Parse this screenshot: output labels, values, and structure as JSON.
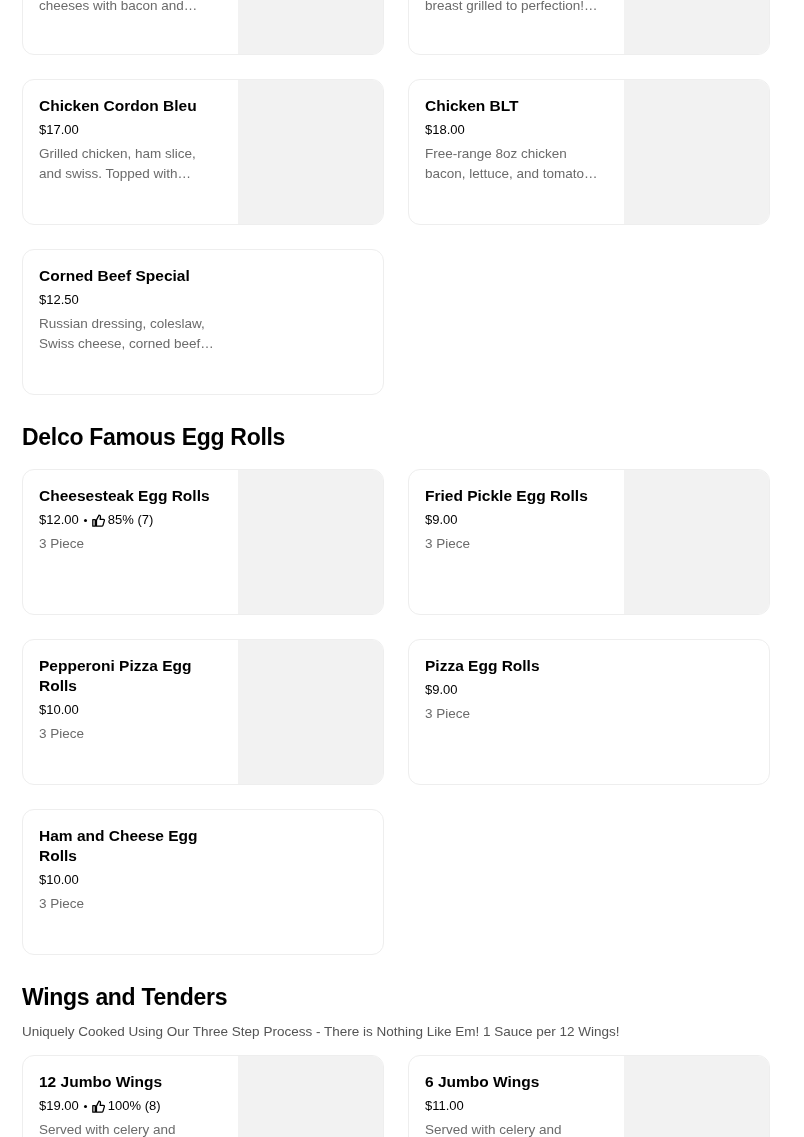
{
  "sections": [
    {
      "items": [
        {
          "kind": "partial",
          "description": "cheeses with bacon and…",
          "image": true
        },
        {
          "kind": "partial",
          "description": "breast grilled to perfection!…",
          "image": true
        },
        {
          "kind": "full",
          "name": "Chicken Cordon Bleu",
          "price": "$17.00",
          "description": "Grilled chicken, ham slice, and swiss. Topped with…",
          "image": true
        },
        {
          "kind": "full",
          "name": "Chicken BLT",
          "price": "$18.00",
          "description": "Free-range 8oz chicken bacon, lettuce, and tomato…",
          "image": true
        },
        {
          "kind": "full",
          "name": "Corned Beef Special",
          "price": "$12.50",
          "description": "Russian dressing, coleslaw, Swiss cheese, corned beef…",
          "image": false
        }
      ]
    },
    {
      "title": "Delco Famous Egg Rolls",
      "items": [
        {
          "kind": "full",
          "name": "Cheesesteak Egg Rolls",
          "price": "$12.00",
          "rating": "85% (7)",
          "description": "3 Piece",
          "image": true
        },
        {
          "kind": "full",
          "name": "Fried Pickle Egg Rolls",
          "price": "$9.00",
          "description": "3 Piece",
          "image": true
        },
        {
          "kind": "full",
          "name": "Pepperoni Pizza Egg Rolls",
          "price": "$10.00",
          "description": "3 Piece",
          "image": true
        },
        {
          "kind": "full",
          "name": "Pizza Egg Rolls",
          "price": "$9.00",
          "description": "3 Piece",
          "image": false
        },
        {
          "kind": "full",
          "name": "Ham and Cheese Egg Rolls",
          "price": "$10.00",
          "description": "3 Piece",
          "image": false
        }
      ]
    },
    {
      "title": "Wings and Tenders",
      "subtitle": "Uniquely Cooked Using Our Three Step Process - There is Nothing Like Em! 1 Sauce per 12 Wings!",
      "items": [
        {
          "kind": "full",
          "name": "12 Jumbo Wings",
          "price": "$19.00",
          "rating": "100% (8)",
          "description": "Served with celery and",
          "image": true
        },
        {
          "kind": "full",
          "name": "6 Jumbo Wings",
          "price": "$11.00",
          "description": "Served with celery and",
          "image": true
        }
      ]
    }
  ]
}
